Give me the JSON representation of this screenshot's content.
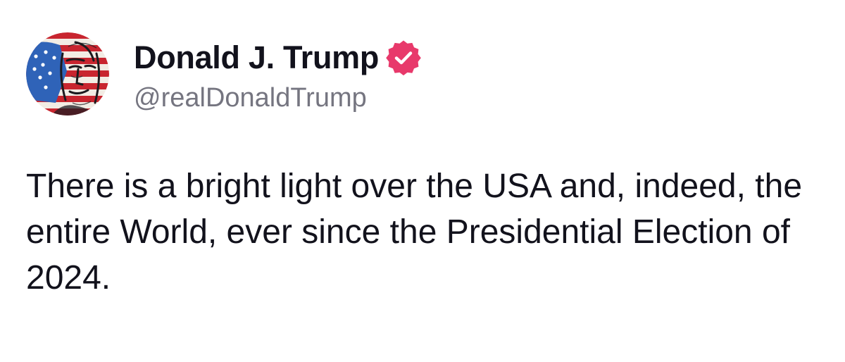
{
  "author": {
    "display_name": "Donald J. Trump",
    "handle": "@realDonaldTrump",
    "verified": true,
    "badge_color": "#e8396b",
    "avatar_icon": "american-flag-portrait"
  },
  "post": {
    "text": "There is a bright light over the USA and, indeed, the entire World, ever since the Presidential Election of 2024."
  }
}
